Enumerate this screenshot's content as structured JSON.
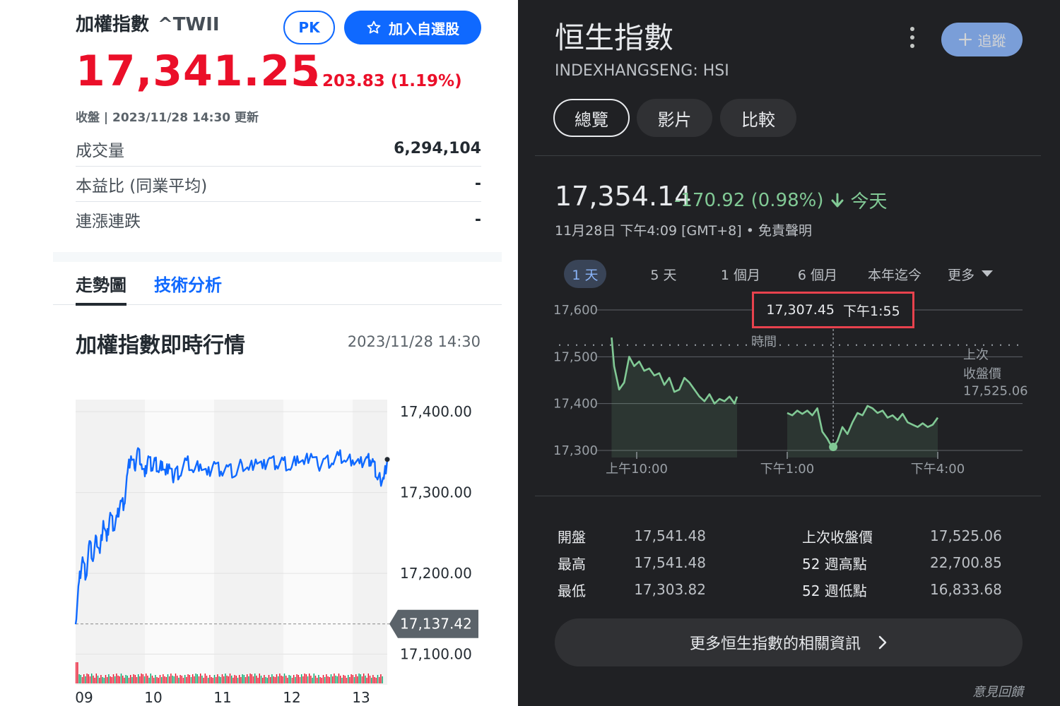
{
  "left": {
    "title": "加權指數",
    "symbol": "^TWII",
    "pk_label": "PK",
    "watch_label": "加入自選股",
    "price": "17,341.25",
    "change": "203.83 (1.19%)",
    "status": "收盤 | 2023/11/28 14:30 更新",
    "stats": [
      {
        "label": "成交量",
        "value": "6,294,104"
      },
      {
        "label": "本益比 (同業平均)",
        "value": "-"
      },
      {
        "label": "連漲連跌",
        "value": "-"
      }
    ],
    "tabs": [
      "走勢圖",
      "技術分析"
    ],
    "section_title": "加權指數即時行情",
    "section_time": "2023/11/28 14:30",
    "colors": {
      "up": "#eb0f29",
      "accent": "#0f69ff"
    },
    "chart_data": {
      "type": "line",
      "title": "",
      "ylim": [
        17090,
        17415
      ],
      "y_ticks": [
        "17,400.00",
        "17,300.00",
        "17,200.00",
        "17,100.00"
      ],
      "y_tick_values": [
        17400,
        17300,
        17200,
        17100
      ],
      "x_ticks": [
        "09",
        "10",
        "11",
        "12",
        "13"
      ],
      "reference_label": "17,137.42",
      "reference_value": 17137.42,
      "series": [
        {
          "x": [
            9.0,
            9.05,
            9.1,
            9.15,
            9.2,
            9.25,
            9.3,
            9.35,
            9.4,
            9.45,
            9.5,
            9.55,
            9.6,
            9.65,
            9.7,
            9.75,
            9.8,
            9.85,
            9.9,
            9.95,
            10.0,
            10.05,
            10.1,
            10.15,
            10.2,
            10.25,
            10.3,
            10.35,
            10.4,
            10.45,
            10.5,
            10.6,
            10.7,
            10.8,
            10.9,
            11.0,
            11.1,
            11.2,
            11.3,
            11.4,
            11.5,
            11.6,
            11.7,
            11.8,
            11.9,
            12.0,
            12.1,
            12.2,
            12.3,
            12.4,
            12.5,
            12.6,
            12.7,
            12.8,
            12.9,
            13.0,
            13.1,
            13.2,
            13.25,
            13.3,
            13.35,
            13.4,
            13.45,
            13.5
          ],
          "y": [
            17137,
            17190,
            17220,
            17195,
            17240,
            17215,
            17245,
            17225,
            17265,
            17240,
            17275,
            17255,
            17270,
            17290,
            17285,
            17325,
            17345,
            17330,
            17355,
            17335,
            17320,
            17345,
            17330,
            17340,
            17325,
            17338,
            17322,
            17335,
            17318,
            17330,
            17320,
            17340,
            17325,
            17335,
            17322,
            17338,
            17326,
            17332,
            17320,
            17336,
            17328,
            17341,
            17330,
            17343,
            17333,
            17340,
            17328,
            17345,
            17335,
            17348,
            17333,
            17342,
            17336,
            17346,
            17338,
            17340,
            17336,
            17344,
            17340,
            17338,
            17318,
            17316,
            17317,
            17341
          ]
        }
      ]
    }
  },
  "right": {
    "title": "恒生指數",
    "symbol": "INDEXHANGSENG: HSI",
    "follow_label": "追蹤",
    "tabs": [
      "總覽",
      "影片",
      "比較"
    ],
    "price": "17,354.14",
    "change": "-170.92 (0.98%)",
    "change_period": "今天",
    "date": "11月28日 下午4:09 [GMT+8] • 免責聲明",
    "ranges": [
      "1 天",
      "5 天",
      "1 個月",
      "6 個月",
      "本年迄今",
      "更多"
    ],
    "tooltip_value": "17,307.45",
    "tooltip_time": "下午1:55",
    "time_label": "時間",
    "prev_close_label_1": "上次",
    "prev_close_label_2": "收盤價",
    "prev_close_value": "17,525.06",
    "colors": {
      "down": "#81c995",
      "accent": "#8ab4f8",
      "highlight": "#e8424d"
    },
    "stats_left": [
      {
        "label": "開盤",
        "value": "17,541.48"
      },
      {
        "label": "最高",
        "value": "17,541.48"
      },
      {
        "label": "最低",
        "value": "17,303.82"
      }
    ],
    "stats_right": [
      {
        "label": "上次收盤價",
        "value": "17,525.06"
      },
      {
        "label": "52 週高點",
        "value": "22,700.85"
      },
      {
        "label": "52 週低點",
        "value": "16,833.68"
      }
    ],
    "more_label": "更多恒生指數的相關資訊",
    "feedback": "意見回饋",
    "chart_data": {
      "type": "area",
      "title": "",
      "ylim": [
        17285,
        17620
      ],
      "y_ticks": [
        "17,600",
        "17,500",
        "17,400",
        "17,300"
      ],
      "y_tick_values": [
        17600,
        17500,
        17400,
        17300
      ],
      "x_ticks": [
        "上午10:00",
        "下午1:00",
        "下午4:00"
      ],
      "x_tick_values": [
        10.0,
        13.0,
        16.0
      ],
      "xlim": [
        9.5,
        17.0
      ],
      "prev_close": 17525.06,
      "cursor_x": 13.917,
      "cursor_value": 17307.45,
      "series": [
        {
          "name": "morning",
          "x": [
            9.5,
            9.55,
            9.65,
            9.75,
            9.85,
            9.95,
            10.05,
            10.15,
            10.25,
            10.35,
            10.45,
            10.55,
            10.65,
            10.75,
            10.85,
            10.95,
            11.05,
            11.15,
            11.25,
            11.35,
            11.45,
            11.55,
            11.65,
            11.75,
            11.85,
            11.95,
            12.0
          ],
          "y": [
            17541,
            17480,
            17430,
            17445,
            17500,
            17480,
            17490,
            17470,
            17475,
            17460,
            17465,
            17440,
            17455,
            17425,
            17430,
            17455,
            17445,
            17430,
            17415,
            17405,
            17420,
            17400,
            17410,
            17405,
            17415,
            17400,
            17415
          ]
        },
        {
          "name": "afternoon",
          "x": [
            13.0,
            13.1,
            13.2,
            13.3,
            13.4,
            13.5,
            13.6,
            13.7,
            13.8,
            13.85,
            13.917,
            14.0,
            14.1,
            14.2,
            14.3,
            14.4,
            14.5,
            14.6,
            14.7,
            14.8,
            14.9,
            15.0,
            15.1,
            15.2,
            15.3,
            15.4,
            15.5,
            15.6,
            15.7,
            15.8,
            15.9,
            16.0
          ],
          "y": [
            17380,
            17375,
            17385,
            17378,
            17385,
            17375,
            17390,
            17340,
            17325,
            17315,
            17307,
            17320,
            17350,
            17335,
            17360,
            17380,
            17375,
            17395,
            17390,
            17380,
            17385,
            17370,
            17375,
            17365,
            17378,
            17360,
            17355,
            17350,
            17358,
            17350,
            17355,
            17370
          ]
        }
      ]
    }
  }
}
